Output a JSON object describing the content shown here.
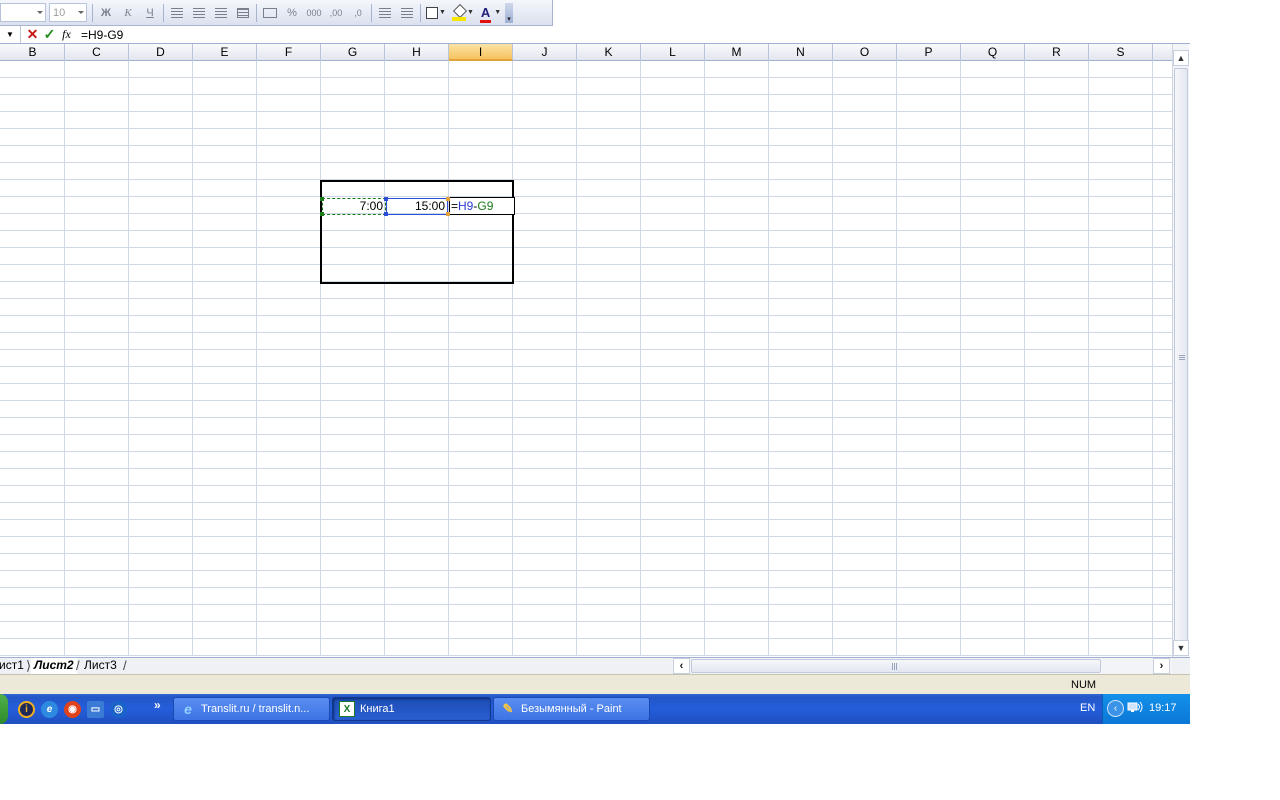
{
  "toolbar": {
    "font_size": "10",
    "bold_label": "Ж",
    "italic_label": "К",
    "underline_label": "Ч",
    "percent_label": "%",
    "thousands_label": "000",
    "dec_inc_label": ",00",
    "dec_dec_label": ",0",
    "font_color_label": "A",
    "fill_color": "#f7e600",
    "font_color": "#e21010"
  },
  "formula_bar": {
    "content": "=H9-G9"
  },
  "columns": [
    "B",
    "C",
    "D",
    "E",
    "F",
    "G",
    "H",
    "I",
    "J",
    "K",
    "L",
    "M",
    "N",
    "O",
    "P",
    "Q",
    "R",
    "S"
  ],
  "active_column": "I",
  "cells": {
    "g9": "7:00",
    "h9": "15:00",
    "i9_prefix": "=",
    "i9_ref1": "H9",
    "i9_op": "-",
    "i9_ref2": "G9"
  },
  "sheets": {
    "tab1": "ист1",
    "tab2": "Лист2",
    "tab3": "Лист3"
  },
  "status": {
    "num": "NUM"
  },
  "taskbar": {
    "tasks": [
      {
        "label": "Translit.ru / translit.n..."
      },
      {
        "label": "Книга1"
      },
      {
        "label": "Безымянный - Paint"
      }
    ],
    "language": "EN",
    "clock": "19:17"
  }
}
